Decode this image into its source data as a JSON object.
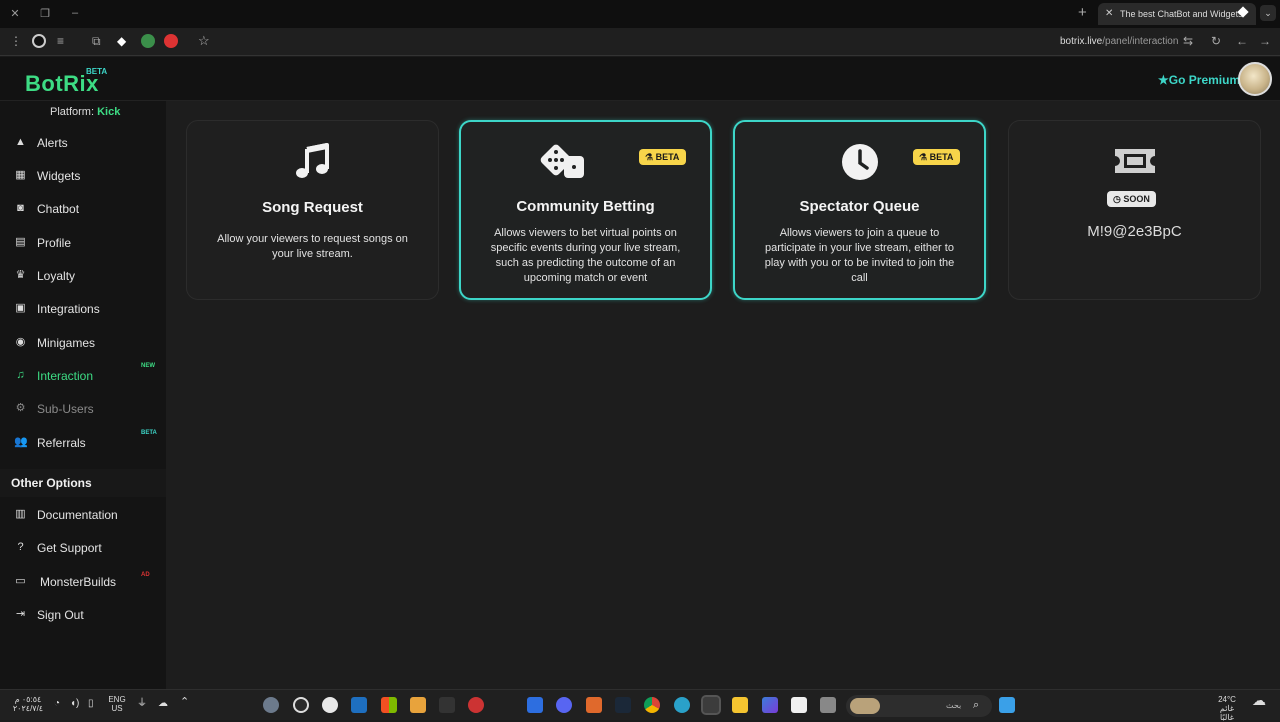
{
  "browser": {
    "tab_title": "The best ChatBot and Widgets",
    "url_host": "botrix.live",
    "url_path": "/panel/interaction"
  },
  "header": {
    "logo": "BotRix",
    "logo_badge": "BETA",
    "premium_label": "Go Premium"
  },
  "sidebar": {
    "platform_label": "Platform:",
    "platform_value": "Kick",
    "items": [
      {
        "label": "Alerts"
      },
      {
        "label": "Widgets"
      },
      {
        "label": "Chatbot"
      },
      {
        "label": "Profile"
      },
      {
        "label": "Loyalty"
      },
      {
        "label": "Integrations"
      },
      {
        "label": "Minigames"
      },
      {
        "label": "Interaction",
        "tag": "NEW"
      },
      {
        "label": "Sub-Users"
      },
      {
        "label": "Referrals",
        "tag": "BETA"
      }
    ],
    "other_title": "Other Options",
    "other_items": [
      {
        "label": "Documentation"
      },
      {
        "label": "Get Support"
      },
      {
        "label": "MonsterBuilds",
        "tag": "AD"
      },
      {
        "label": "Sign Out"
      }
    ]
  },
  "cards": [
    {
      "title": "Song Request",
      "desc": "Allow your viewers to request songs on your live stream.",
      "icon": "music-icon"
    },
    {
      "title": "Community Betting",
      "desc": "Allows viewers to bet virtual points on specific events during your live stream, such as predicting the outcome of an upcoming match or event",
      "badge": "BETA",
      "icon": "dice-icon"
    },
    {
      "title": "Spectator Queue",
      "desc": "Allows viewers to join a queue to participate in your live stream, either to play with you or to be invited to join the call",
      "badge": "BETA",
      "icon": "clock-icon"
    },
    {
      "badge": "SOON",
      "code": "M!9@2e3BpC",
      "icon": "ticket-icon"
    }
  ],
  "taskbar": {
    "weather_temp": "24°C",
    "weather_desc": "غائم غالبًا",
    "lang_top": "ENG",
    "lang_bottom": "US",
    "search_placeholder": "بحث",
    "clock_time": "٠٥:٥٤ م",
    "clock_date": "٢٠٢٤/٧/٤"
  },
  "colors": {
    "accent_green": "#3ddc84",
    "accent_teal": "#3dd6c8",
    "beta_yellow": "#f7d54a"
  }
}
